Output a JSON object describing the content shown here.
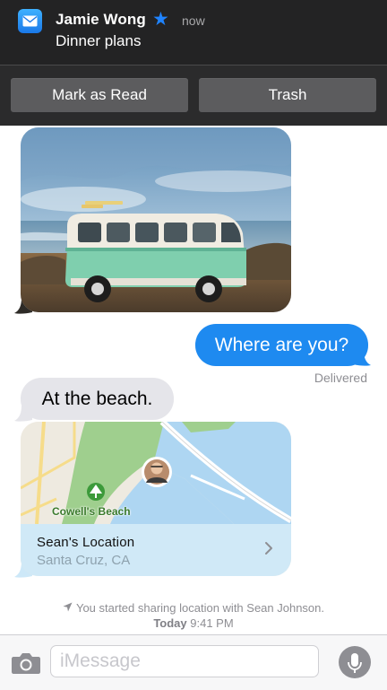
{
  "notification": {
    "sender": "Jamie Wong",
    "time": "now",
    "preview": "Dinner plans",
    "actions": {
      "mark_read": "Mark as Read",
      "trash": "Trash"
    }
  },
  "conversation": {
    "outgoing_message": "Where are you?",
    "delivery_status": "Delivered",
    "incoming_message": "At the beach.",
    "location_card": {
      "map_label": "Cowell's Beach",
      "title": "Sean's Location",
      "subtitle": "Santa Cruz, CA"
    },
    "system_notice": {
      "line1": "You started sharing location with Sean Johnson.",
      "day": "Today",
      "time": "9:41 PM"
    }
  },
  "input_bar": {
    "placeholder": "iMessage"
  },
  "colors": {
    "banner_bg": "#232324",
    "outgoing_bubble": "#1e8af0",
    "incoming_bubble": "#e5e5ea",
    "vip_star": "#1f83ff",
    "map_water": "#aed6f2",
    "map_park": "#9fcf8e"
  },
  "icons": {
    "app": "mail-icon",
    "star": "vip-star-icon",
    "location_arrow": "location-arrow-icon",
    "chevron": "chevron-right-icon",
    "camera": "camera-icon",
    "microphone": "microphone-icon",
    "park_pin": "park-icon"
  }
}
